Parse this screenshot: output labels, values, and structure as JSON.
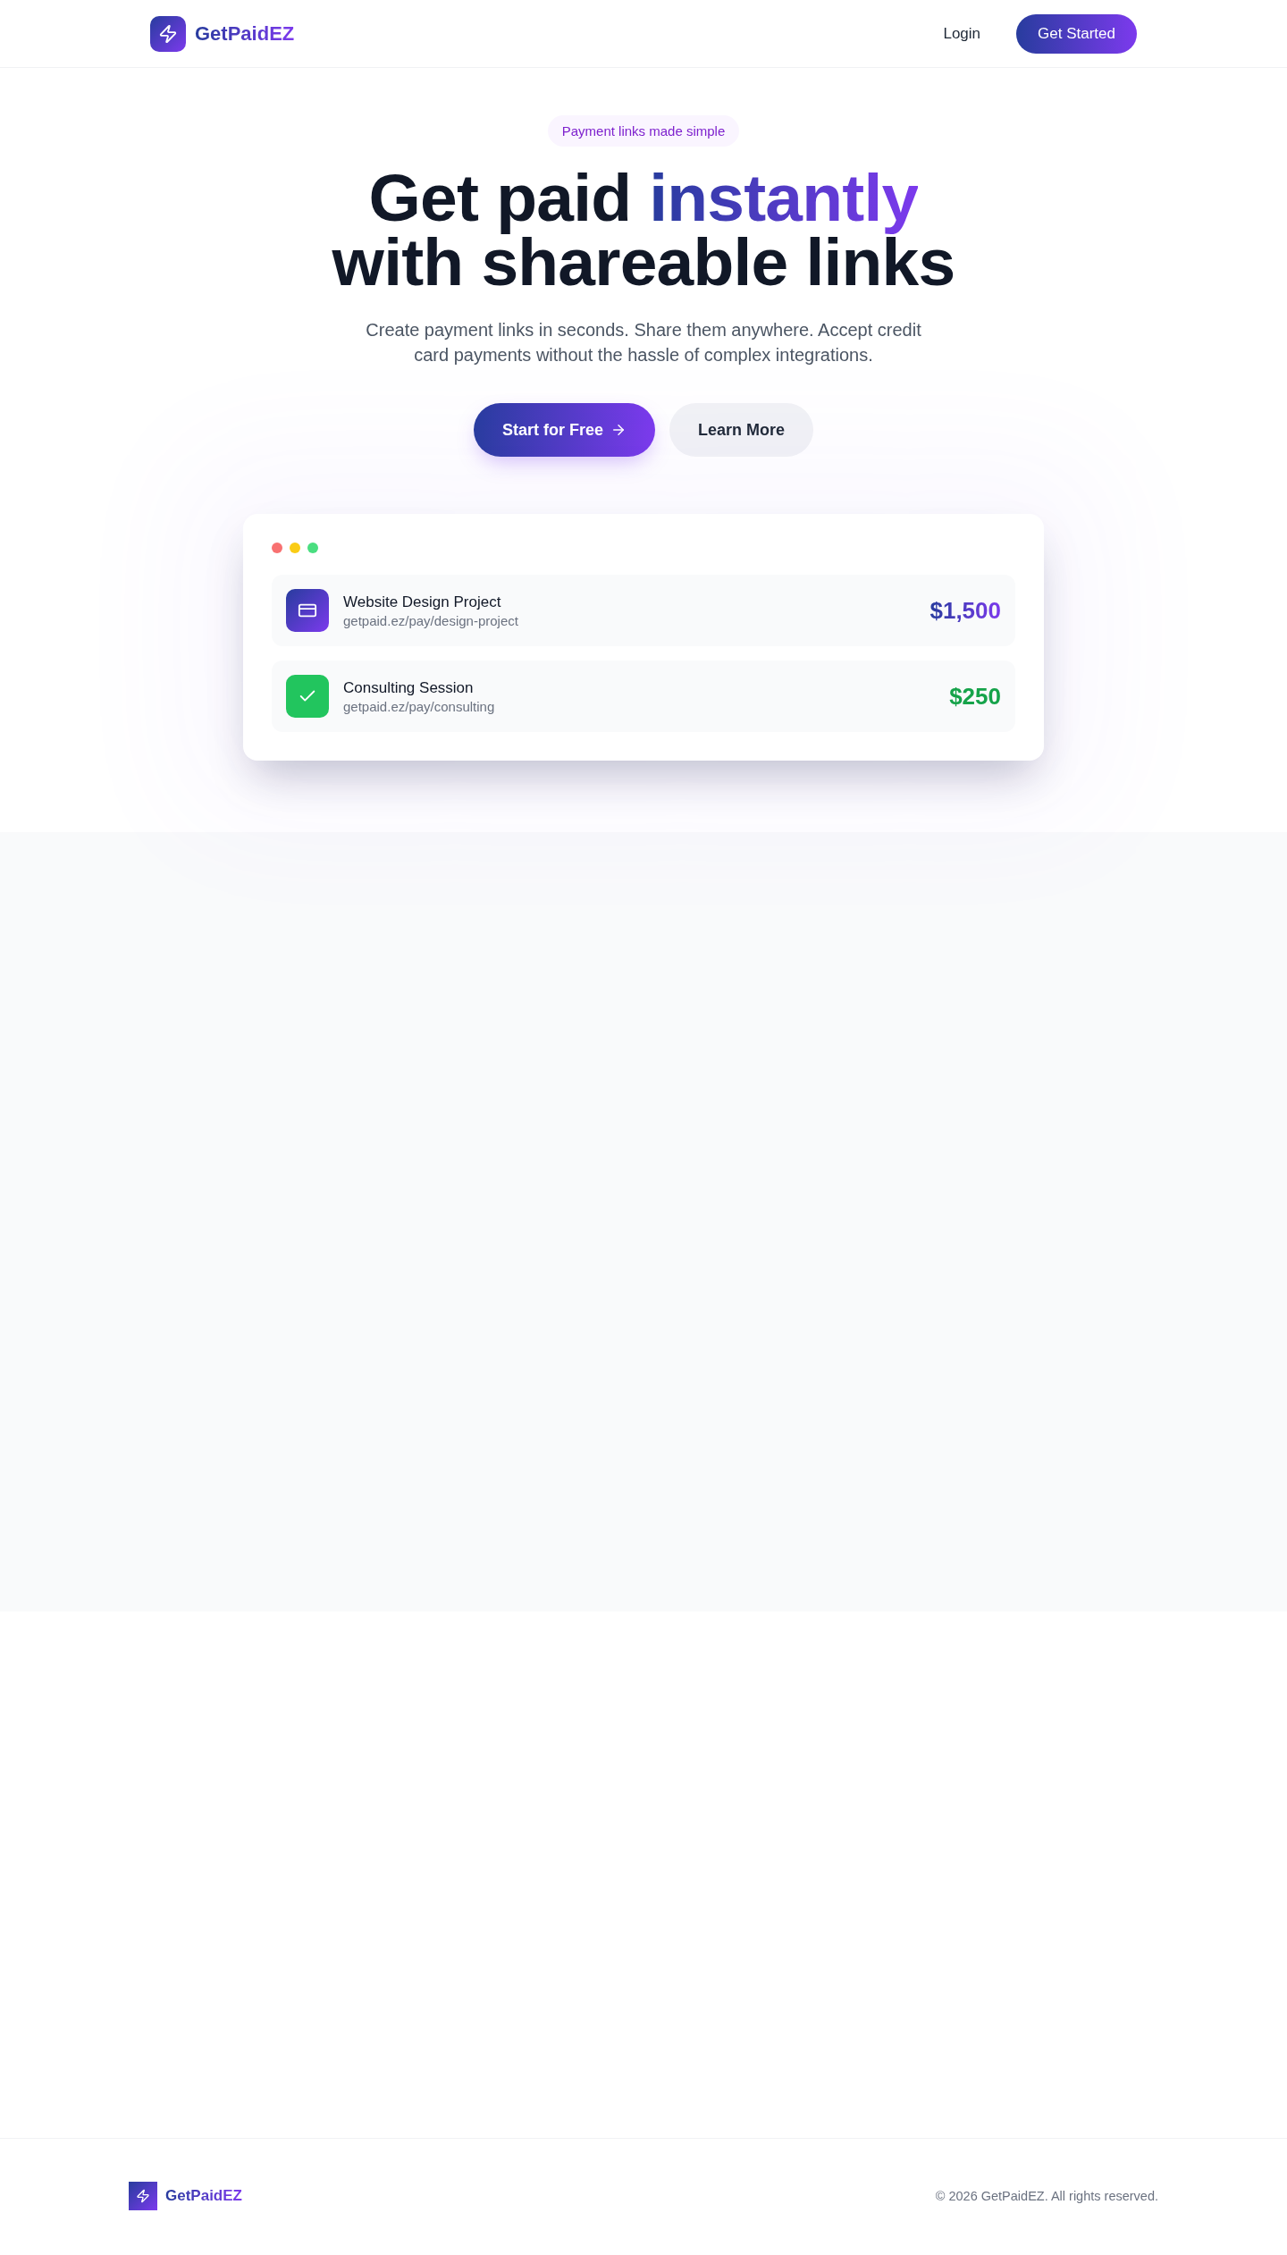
{
  "header": {
    "brand": "GetPaidEZ",
    "nav": [
      {
        "label": "Login",
        "kind": "link"
      },
      {
        "label": "Get Started",
        "kind": "primary"
      }
    ]
  },
  "hero": {
    "badge": "Payment links made simple",
    "title": {
      "before": "Get paid ",
      "highlight": "instantly",
      "after": "with shareable links"
    },
    "subtitle": "Create payment links in seconds. Share them anywhere. Accept credit card payments without the hassle of complex integrations.",
    "buttons": [
      {
        "label": "Start for Free",
        "kind": "primary"
      },
      {
        "label": "Learn More",
        "kind": "secondary"
      }
    ]
  },
  "preview": {
    "links": [
      {
        "title": "Website Design Project",
        "url": "getpaid.ez/pay/design-project",
        "amount": "$1,500",
        "kind": "card"
      },
      {
        "title": "Consulting Session",
        "url": "getpaid.ez/pay/consulting",
        "amount": "$250",
        "kind": "paid"
      }
    ]
  },
  "footer": {
    "brand": "GetPaidEZ",
    "copyright": "© 2026 GetPaidEZ. All rights reserved."
  }
}
